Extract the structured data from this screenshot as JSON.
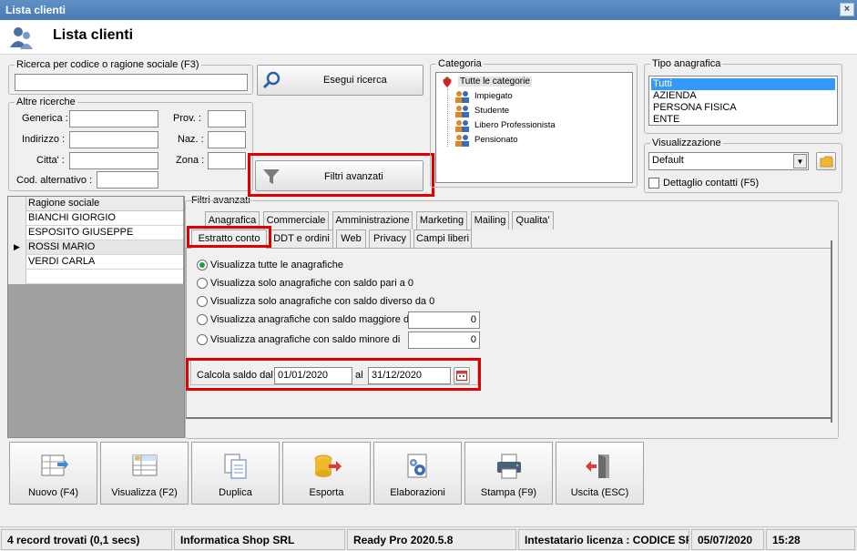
{
  "window": {
    "title": "Lista clienti",
    "header": "Lista clienti"
  },
  "search": {
    "group_label": "Ricerca per codice o ragione sociale (F3)",
    "value": "",
    "button": "Esegui ricerca"
  },
  "altre": {
    "group_label": "Altre ricerche",
    "generica": "Generica :",
    "indirizzo": "Indirizzo :",
    "citta": "Citta' :",
    "cod_alt": "Cod. alternativo :",
    "prov": "Prov. :",
    "naz": "Naz. :",
    "zona": "Zona :"
  },
  "filtri_button": "Filtri avanzati",
  "categoria": {
    "group_label": "Categoria",
    "root": "Tutte le categorie",
    "items": [
      "Impiegato",
      "Studente",
      "Libero Professionista",
      "Pensionato"
    ]
  },
  "tipo": {
    "group_label": "Tipo anagrafica",
    "items": [
      "Tutti",
      "AZIENDA",
      "PERSONA FISICA",
      "ENTE"
    ]
  },
  "visualizzazione": {
    "group_label": "Visualizzazione",
    "selected": "Default",
    "dettaglio": "Dettaglio contatti (F5)"
  },
  "grid": {
    "header": "Ragione sociale",
    "rows": [
      "BIANCHI GIORGIO",
      "ESPOSITO GIUSEPPE",
      "ROSSI MARIO",
      "VERDI CARLA"
    ]
  },
  "filtri": {
    "label": "Filtri avanzati",
    "tabs_row1": [
      "Anagrafica",
      "Commerciale",
      "Amministrazione",
      "Marketing",
      "Mailing",
      "Qualita'"
    ],
    "tabs_row2": [
      "Estratto conto",
      "DDT e ordini",
      "Web",
      "Privacy",
      "Campi liberi"
    ],
    "options": [
      "Visualizza tutte le anagrafiche",
      "Visualizza solo anagrafiche con saldo pari a 0",
      "Visualizza solo anagrafiche con saldo diverso da 0",
      "Visualizza anagrafiche con saldo maggiore di",
      "Visualizza anagrafiche con saldo minore di"
    ],
    "maggiore_value": "0",
    "minore_value": "0",
    "calcola_label": "Calcola saldo dal",
    "dal": "01/01/2020",
    "al_label": "al",
    "al": "31/12/2020"
  },
  "buttons": [
    "Nuovo (F4)",
    "Visualizza (F2)",
    "Duplica",
    "Esporta",
    "Elaborazioni",
    "Stampa (F9)",
    "Uscita (ESC)"
  ],
  "status": {
    "records": "4 record trovati (0,1 secs)",
    "company": "Informatica Shop SRL",
    "version": "Ready Pro 2020.5.8",
    "license": "Intestatario licenza : CODICE SRL",
    "date": "05/07/2020",
    "time": "15:28"
  },
  "colors": {
    "accent": "#3399ff",
    "highlight": "#e00000",
    "title": "#4a7bb2"
  }
}
